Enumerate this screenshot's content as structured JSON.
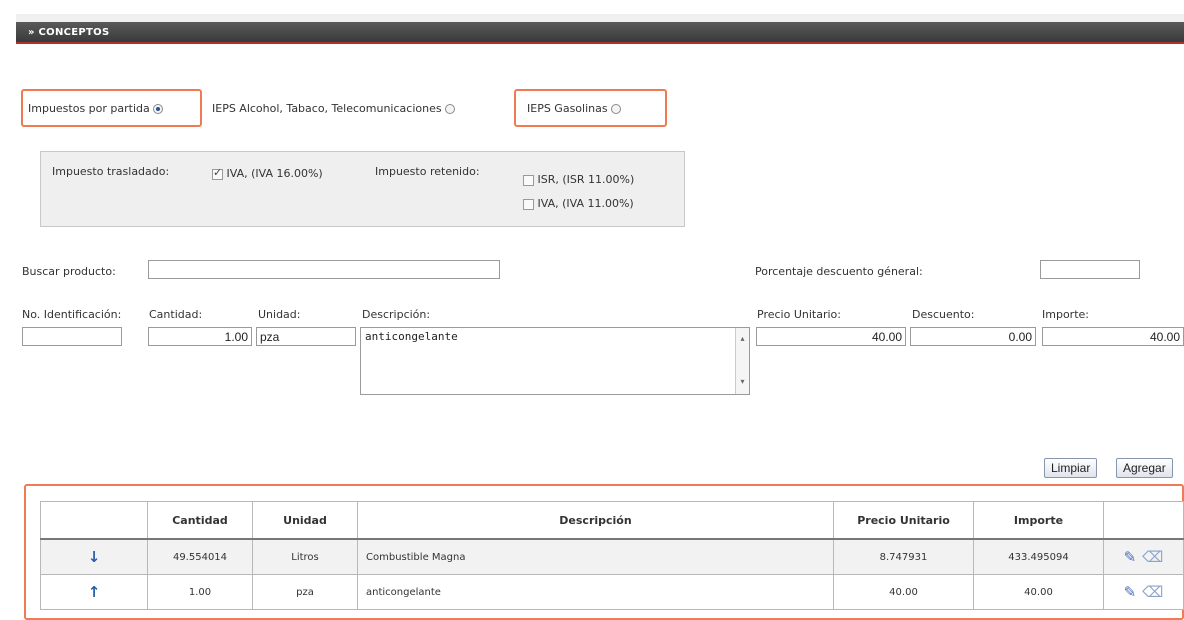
{
  "section": {
    "title": "» CONCEPTOS"
  },
  "tax_mode": {
    "options": [
      {
        "label": "Impuestos por partida",
        "selected": true
      },
      {
        "label": "IEPS Alcohol, Tabaco, Telecomunicaciones",
        "selected": false
      },
      {
        "label": "IEPS Gasolinas",
        "selected": false
      }
    ]
  },
  "taxes": {
    "trasladado_label": "Impuesto trasladado:",
    "trasladado_items": [
      {
        "label": "IVA, (IVA 16.00%)",
        "checked": true
      }
    ],
    "retenido_label": "Impuesto retenido:",
    "retenido_items": [
      {
        "label": "ISR, (ISR 11.00%)",
        "checked": false
      },
      {
        "label": "IVA, (IVA 11.00%)",
        "checked": false
      }
    ]
  },
  "search": {
    "label": "Buscar producto:",
    "value": ""
  },
  "discount_general": {
    "label": "Porcentaje descuento géneral:",
    "value": ""
  },
  "form": {
    "id_label": "No. Identificación:",
    "id_value": "",
    "cantidad_label": "Cantidad:",
    "cantidad_value": "1.00",
    "unidad_label": "Unidad:",
    "unidad_value": "pza",
    "descripcion_label": "Descripción:",
    "descripcion_value": "anticongelante",
    "precio_label": "Precio Unitario:",
    "precio_value": "40.00",
    "descuento_label": "Descuento:",
    "descuento_value": "0.00",
    "importe_label": "Importe:",
    "importe_value": "40.00"
  },
  "buttons": {
    "limpiar": "Limpiar",
    "agregar": "Agregar"
  },
  "table": {
    "headers": [
      "",
      "Cantidad",
      "Unidad",
      "Descripción",
      "Precio Unitario",
      "Importe",
      ""
    ],
    "rows": [
      {
        "arrow": "↓",
        "cantidad": "49.554014",
        "unidad": "Litros",
        "descripcion": "Combustible Magna",
        "precio": "8.747931",
        "importe": "433.495094"
      },
      {
        "arrow": "↑",
        "cantidad": "1.00",
        "unidad": "pza",
        "descripcion": "anticongelante",
        "precio": "40.00",
        "importe": "40.00"
      }
    ]
  },
  "colors": {
    "header_bg": "#4a4a4a",
    "header_accent": "#a8342d",
    "highlight": "#f07a52",
    "link_blue": "#2a5ea8"
  },
  "icons": [
    "radio-icon",
    "checkbox-icon",
    "arrow-down-icon",
    "arrow-up-icon",
    "edit-pencil-icon",
    "eraser-icon"
  ]
}
